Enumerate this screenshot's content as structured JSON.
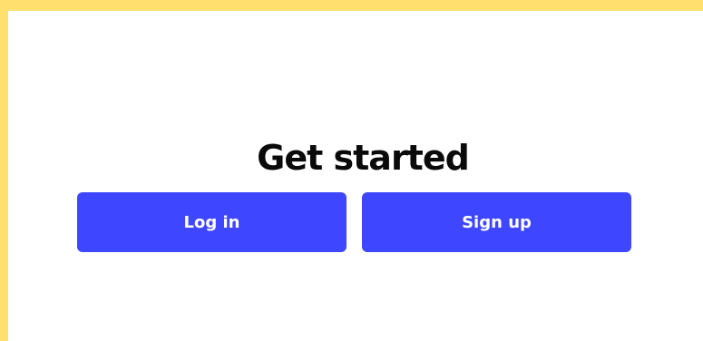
{
  "page": {
    "title": "Get started"
  },
  "actions": {
    "login_label": "Log in",
    "signup_label": "Sign up"
  },
  "colors": {
    "frame": "#FFE06F",
    "panel": "#FFFFFF",
    "button": "#3E47FF",
    "button_text": "#FFFFFF",
    "title_text": "#0A0A0A"
  }
}
